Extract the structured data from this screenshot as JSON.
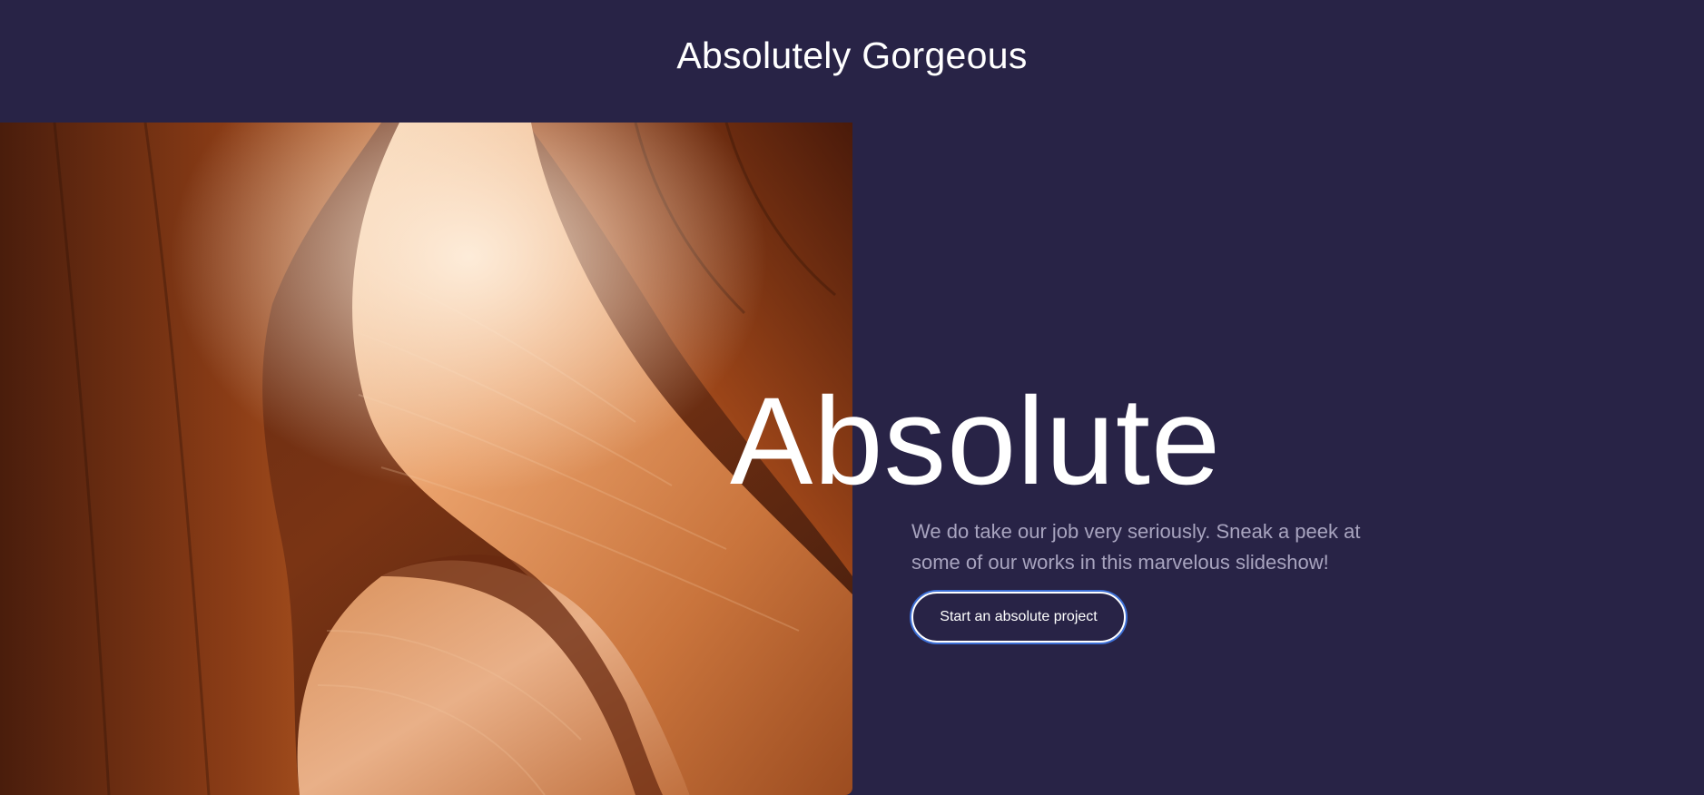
{
  "header": {
    "title": "Absolutely Gorgeous"
  },
  "hero": {
    "image_alt": "canyon-photo",
    "heading": "Absolute",
    "description": "We do take our job very seriously. Sneak a peek at some of our works in this marvelous slideshow!",
    "cta_label": "Start an absolute project"
  },
  "colors": {
    "background": "#282346",
    "text": "#ffffff",
    "muted_text": "#a8a4bf",
    "focus_ring": "#3d6fd6"
  }
}
